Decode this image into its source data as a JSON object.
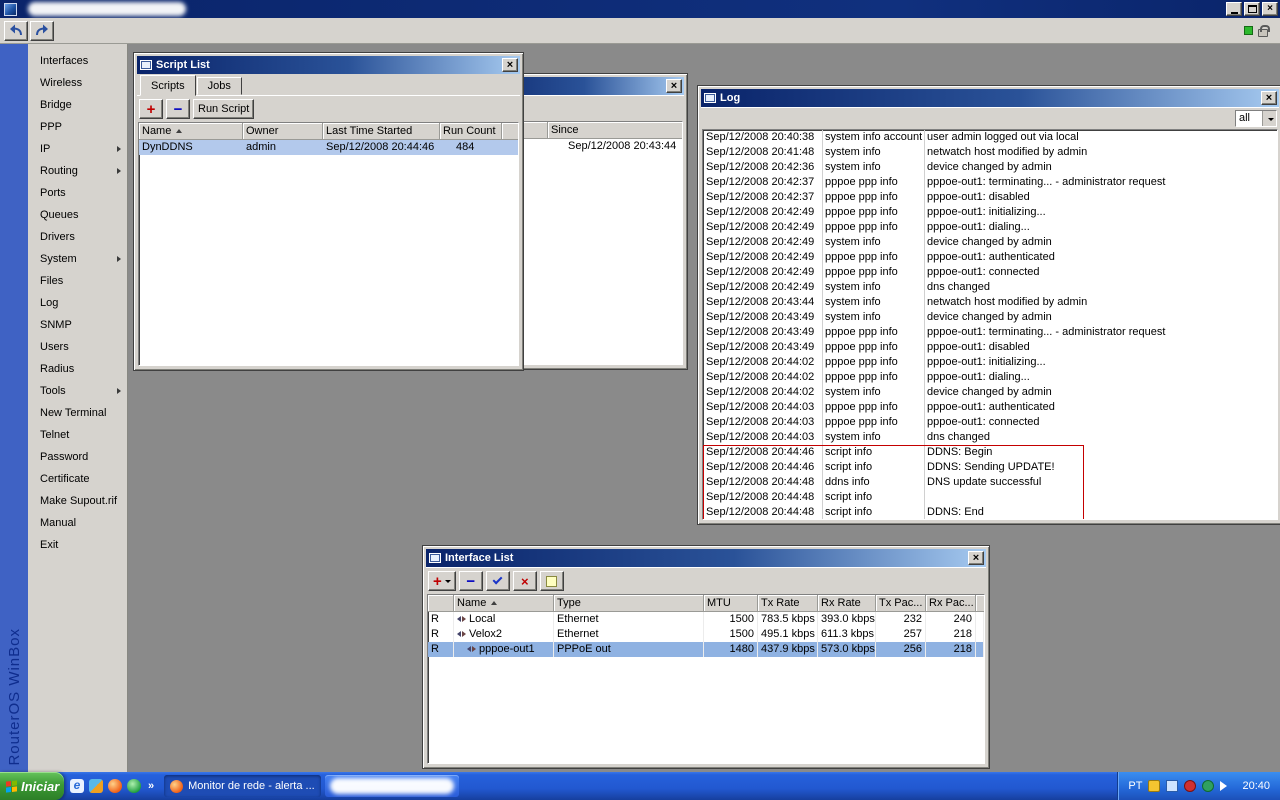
{
  "icons": {
    "close": "×",
    "add": "+",
    "remove": "−",
    "more": "»",
    "ie_glyph": "e"
  },
  "brand": "RouterOS WinBox",
  "sidebar": {
    "items": [
      {
        "label": "Interfaces",
        "arrow": false
      },
      {
        "label": "Wireless",
        "arrow": false
      },
      {
        "label": "Bridge",
        "arrow": false
      },
      {
        "label": "PPP",
        "arrow": false
      },
      {
        "label": "IP",
        "arrow": true
      },
      {
        "label": "Routing",
        "arrow": true
      },
      {
        "label": "Ports",
        "arrow": false
      },
      {
        "label": "Queues",
        "arrow": false
      },
      {
        "label": "Drivers",
        "arrow": false
      },
      {
        "label": "System",
        "arrow": true
      },
      {
        "label": "Files",
        "arrow": false
      },
      {
        "label": "Log",
        "arrow": false
      },
      {
        "label": "SNMP",
        "arrow": false
      },
      {
        "label": "Users",
        "arrow": false
      },
      {
        "label": "Radius",
        "arrow": false
      },
      {
        "label": "Tools",
        "arrow": true
      },
      {
        "label": "New Terminal",
        "arrow": false
      },
      {
        "label": "Telnet",
        "arrow": false
      },
      {
        "label": "Password",
        "arrow": false
      },
      {
        "label": "Certificate",
        "arrow": false
      },
      {
        "label": "Make Supout.rif",
        "arrow": false
      },
      {
        "label": "Manual",
        "arrow": false
      },
      {
        "label": "Exit",
        "arrow": false
      }
    ]
  },
  "windows": {
    "script_list": {
      "title": "Script List",
      "tabs": [
        {
          "label": "Scripts",
          "active": true
        },
        {
          "label": "Jobs",
          "active": false
        }
      ],
      "run_button": "Run Script",
      "columns": [
        "Name",
        "Owner",
        "Last Time Started",
        "Run Count"
      ],
      "rows": [
        {
          "name": "DynDDNS",
          "owner": "admin",
          "last_time_started": "Sep/12/2008 20:44:46",
          "run_count": "484",
          "selected": true
        }
      ]
    },
    "netwatch": {
      "since_column": "Since",
      "rows": [
        {
          "since": "Sep/12/2008 20:43:44"
        }
      ]
    },
    "log": {
      "title": "Log",
      "filter": "all",
      "entries": [
        {
          "time": "Sep/12/2008 20:40:38",
          "topics": "system info account",
          "message": "user admin logged out via local"
        },
        {
          "time": "Sep/12/2008 20:41:48",
          "topics": "system info",
          "message": "netwatch host modified by admin"
        },
        {
          "time": "Sep/12/2008 20:42:36",
          "topics": "system info",
          "message": "device changed by admin"
        },
        {
          "time": "Sep/12/2008 20:42:37",
          "topics": "pppoe ppp info",
          "message": "pppoe-out1: terminating... - administrator request"
        },
        {
          "time": "Sep/12/2008 20:42:37",
          "topics": "pppoe ppp info",
          "message": "pppoe-out1: disabled"
        },
        {
          "time": "Sep/12/2008 20:42:49",
          "topics": "pppoe ppp info",
          "message": "pppoe-out1: initializing..."
        },
        {
          "time": "Sep/12/2008 20:42:49",
          "topics": "pppoe ppp info",
          "message": "pppoe-out1: dialing..."
        },
        {
          "time": "Sep/12/2008 20:42:49",
          "topics": "system info",
          "message": "device changed by admin"
        },
        {
          "time": "Sep/12/2008 20:42:49",
          "topics": "pppoe ppp info",
          "message": "pppoe-out1: authenticated"
        },
        {
          "time": "Sep/12/2008 20:42:49",
          "topics": "pppoe ppp info",
          "message": "pppoe-out1: connected"
        },
        {
          "time": "Sep/12/2008 20:42:49",
          "topics": "system info",
          "message": "dns changed"
        },
        {
          "time": "Sep/12/2008 20:43:44",
          "topics": "system info",
          "message": "netwatch host modified by admin"
        },
        {
          "time": "Sep/12/2008 20:43:49",
          "topics": "system info",
          "message": "device changed by admin"
        },
        {
          "time": "Sep/12/2008 20:43:49",
          "topics": "pppoe ppp info",
          "message": "pppoe-out1: terminating... - administrator request"
        },
        {
          "time": "Sep/12/2008 20:43:49",
          "topics": "pppoe ppp info",
          "message": "pppoe-out1: disabled"
        },
        {
          "time": "Sep/12/2008 20:44:02",
          "topics": "pppoe ppp info",
          "message": "pppoe-out1: initializing..."
        },
        {
          "time": "Sep/12/2008 20:44:02",
          "topics": "pppoe ppp info",
          "message": "pppoe-out1: dialing..."
        },
        {
          "time": "Sep/12/2008 20:44:02",
          "topics": "system info",
          "message": "device changed by admin"
        },
        {
          "time": "Sep/12/2008 20:44:03",
          "topics": "pppoe ppp info",
          "message": "pppoe-out1: authenticated"
        },
        {
          "time": "Sep/12/2008 20:44:03",
          "topics": "pppoe ppp info",
          "message": "pppoe-out1: connected"
        },
        {
          "time": "Sep/12/2008 20:44:03",
          "topics": "system info",
          "message": "dns changed"
        },
        {
          "time": "Sep/12/2008 20:44:46",
          "topics": "script info",
          "message": "DDNS: Begin"
        },
        {
          "time": "Sep/12/2008 20:44:46",
          "topics": "script info",
          "message": "DDNS: Sending UPDATE!"
        },
        {
          "time": "Sep/12/2008 20:44:48",
          "topics": "ddns info",
          "message": "DNS update successful"
        },
        {
          "time": "Sep/12/2008 20:44:48",
          "topics": "script info",
          "message": ""
        },
        {
          "time": "Sep/12/2008 20:44:48",
          "topics": "script info",
          "message": "DDNS: End"
        }
      ],
      "highlight_color": "#c40000"
    },
    "interface_list": {
      "title": "Interface List",
      "columns": [
        "Name",
        "Type",
        "MTU",
        "Tx Rate",
        "Rx Rate",
        "Tx Pac...",
        "Rx Pac..."
      ],
      "rows": [
        {
          "flag": "R",
          "name": "Local",
          "type": "Ethernet",
          "mtu": "1500",
          "tx_rate": "783.5 kbps",
          "rx_rate": "393.0 kbps",
          "tx_pac": "232",
          "rx_pac": "240",
          "selected": false,
          "indent": false
        },
        {
          "flag": "R",
          "name": "Velox2",
          "type": "Ethernet",
          "mtu": "1500",
          "tx_rate": "495.1 kbps",
          "rx_rate": "611.3 kbps",
          "tx_pac": "257",
          "rx_pac": "218",
          "selected": false,
          "indent": false
        },
        {
          "flag": "R",
          "name": "pppoe-out1",
          "type": "PPPoE out",
          "mtu": "1480",
          "tx_rate": "437.9 kbps",
          "rx_rate": "573.0 kbps",
          "tx_pac": "256",
          "rx_pac": "218",
          "selected": true,
          "indent": true
        }
      ]
    }
  },
  "taskbar": {
    "start_label": "Iniciar",
    "task1": {
      "label": "Monitor de rede - alerta ..."
    },
    "task2": {
      "label": ""
    },
    "tray": {
      "lang": "PT",
      "time": "20:40"
    }
  }
}
